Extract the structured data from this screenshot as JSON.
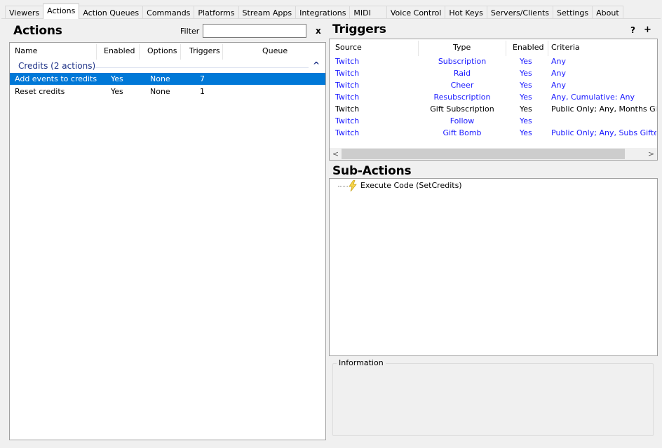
{
  "tabs": [
    "Viewers",
    "Actions",
    "Action Queues",
    "Commands",
    "Platforms",
    "Stream Apps",
    "Integrations",
    "MIDI",
    "Voice Control",
    "Hot Keys",
    "Servers/Clients",
    "Settings",
    "About"
  ],
  "active_tab": "Actions",
  "actions": {
    "title": "Actions",
    "filter_label": "Filter",
    "filter_value": "",
    "clear_label": "x",
    "sort_indicator": "^",
    "columns": [
      "Name",
      "Enabled",
      "Options",
      "Triggers",
      "Queue"
    ],
    "group_label": "Credits (2 actions)",
    "group_chevron": "^",
    "rows": [
      {
        "name": "Add events to credits",
        "enabled": "Yes",
        "options": "None",
        "triggers": "7",
        "queue": ""
      },
      {
        "name": "Reset credits",
        "enabled": "Yes",
        "options": "None",
        "triggers": "1",
        "queue": ""
      }
    ]
  },
  "triggers": {
    "title": "Triggers",
    "help_label": "?",
    "add_label": "+",
    "columns": [
      "Source",
      "Type",
      "Enabled",
      "Criteria"
    ],
    "rows": [
      {
        "source": "Twitch",
        "type": "Subscription",
        "enabled": "Yes",
        "criteria": "Any",
        "blue": true
      },
      {
        "source": "Twitch",
        "type": "Raid",
        "enabled": "Yes",
        "criteria": "Any",
        "blue": true
      },
      {
        "source": "Twitch",
        "type": "Cheer",
        "enabled": "Yes",
        "criteria": "Any",
        "blue": true
      },
      {
        "source": "Twitch",
        "type": "Resubscription",
        "enabled": "Yes",
        "criteria": "Any, Cumulative: Any",
        "blue": true
      },
      {
        "source": "Twitch",
        "type": "Gift Subscription",
        "enabled": "Yes",
        "criteria": "Public Only; Any, Months Gifted",
        "blue": false
      },
      {
        "source": "Twitch",
        "type": "Follow",
        "enabled": "Yes",
        "criteria": "",
        "blue": true
      },
      {
        "source": "Twitch",
        "type": "Gift Bomb",
        "enabled": "Yes",
        "criteria": "Public Only; Any, Subs Gifted: A",
        "blue": true
      }
    ],
    "scroll_left": "<",
    "scroll_right": ">"
  },
  "subactions": {
    "title": "Sub-Actions",
    "items": [
      {
        "label": "Execute Code (SetCredits)",
        "icon": "lightning-icon"
      }
    ]
  },
  "information": {
    "label": "Information"
  },
  "colors": {
    "selection": "#0078d7",
    "link_blue": "#1a1aff",
    "group_blue": "#1e3287"
  }
}
